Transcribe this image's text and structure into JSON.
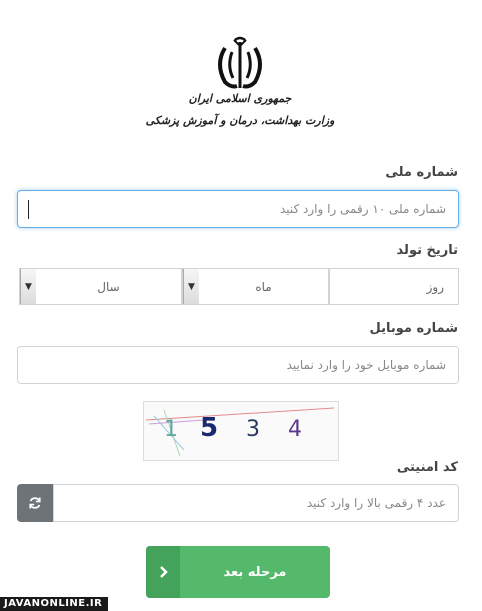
{
  "header": {
    "org_line1": "جمهوری اسلامی ایران",
    "org_line2": "وزارت بهداشت، درمان و آموزش پزشکی"
  },
  "national_id": {
    "label": "شماره ملی",
    "placeholder": "شماره ملی ۱۰ رقمی را وارد کنید"
  },
  "birth_date": {
    "label": "تاریخ تولد",
    "day_label": "روز",
    "month_label": "ماه",
    "year_label": "سال"
  },
  "mobile": {
    "label": "شماره موبایل",
    "placeholder": "شماره موبایل خود را وارد نمایید"
  },
  "captcha": {
    "digits": [
      "1",
      "5",
      "3",
      "4"
    ],
    "digit_colors": [
      "#5fa8a0",
      "#1a2a6e",
      "#2a3a5e",
      "#5a3a8e"
    ]
  },
  "security_code": {
    "label": "کد امنیتی",
    "placeholder": "عدد ۴ رقمی بالا را وارد کنید"
  },
  "next_button": {
    "label": "مرحله بعد"
  },
  "watermark": "JAVANONLINE.IR",
  "colors": {
    "primary_green": "#54b96b",
    "focus_blue": "#66afe9",
    "refresh_gray": "#6e7378"
  },
  "icons": {
    "refresh": "refresh-icon",
    "next": "chevron-left-icon",
    "emblem": "iran-emblem-icon"
  }
}
